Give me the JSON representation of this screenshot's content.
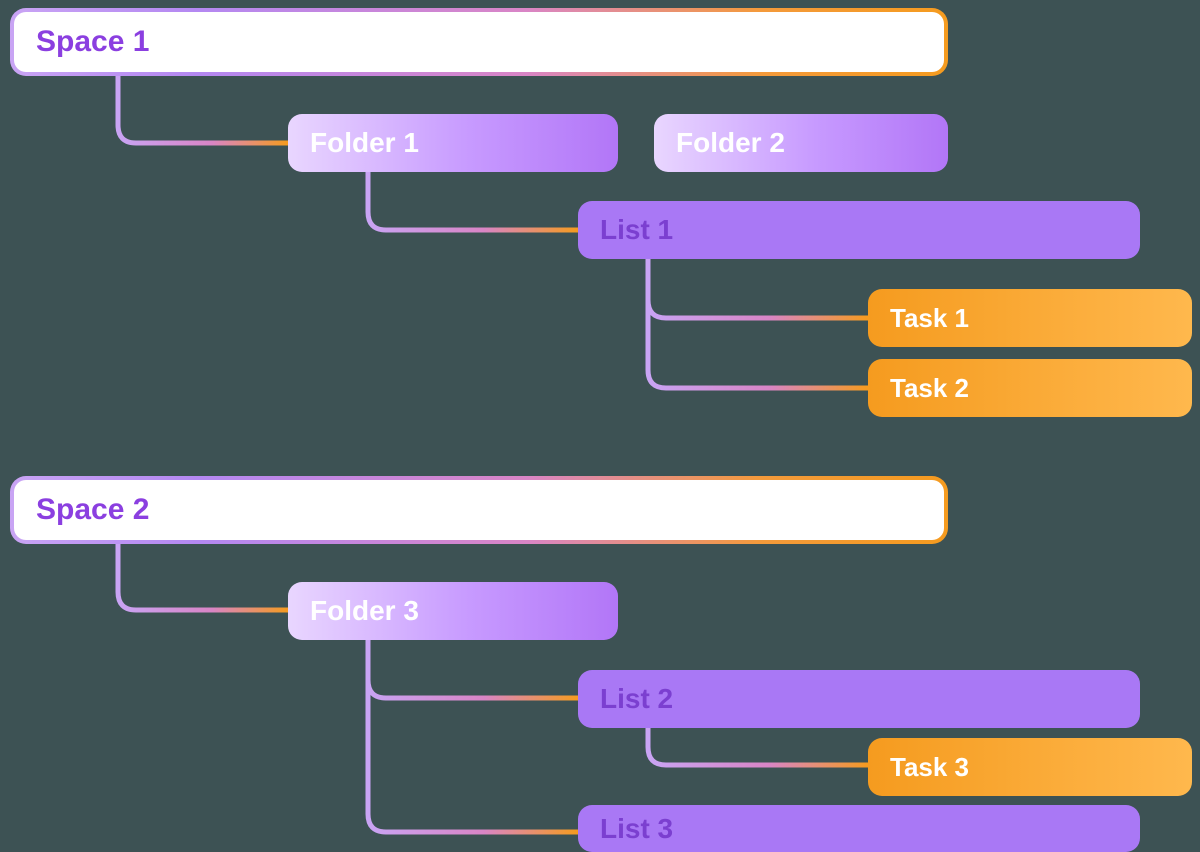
{
  "spaces": [
    {
      "label": "Space 1",
      "folders": [
        {
          "label": "Folder 1",
          "lists": [
            {
              "label": "List 1",
              "tasks": [
                {
                  "label": "Task 1"
                },
                {
                  "label": "Task 2"
                }
              ]
            }
          ]
        },
        {
          "label": "Folder 2",
          "lists": []
        }
      ]
    },
    {
      "label": "Space 2",
      "folders": [
        {
          "label": "Folder 3",
          "lists": [
            {
              "label": "List 2",
              "tasks": [
                {
                  "label": "Task 3"
                }
              ]
            },
            {
              "label": "List 3",
              "tasks": []
            }
          ]
        }
      ]
    }
  ],
  "colors": {
    "purple": "#8b3fe0",
    "lilac": "#c9a4f4",
    "orange": "#f59b1f",
    "background": "#3d5254"
  }
}
